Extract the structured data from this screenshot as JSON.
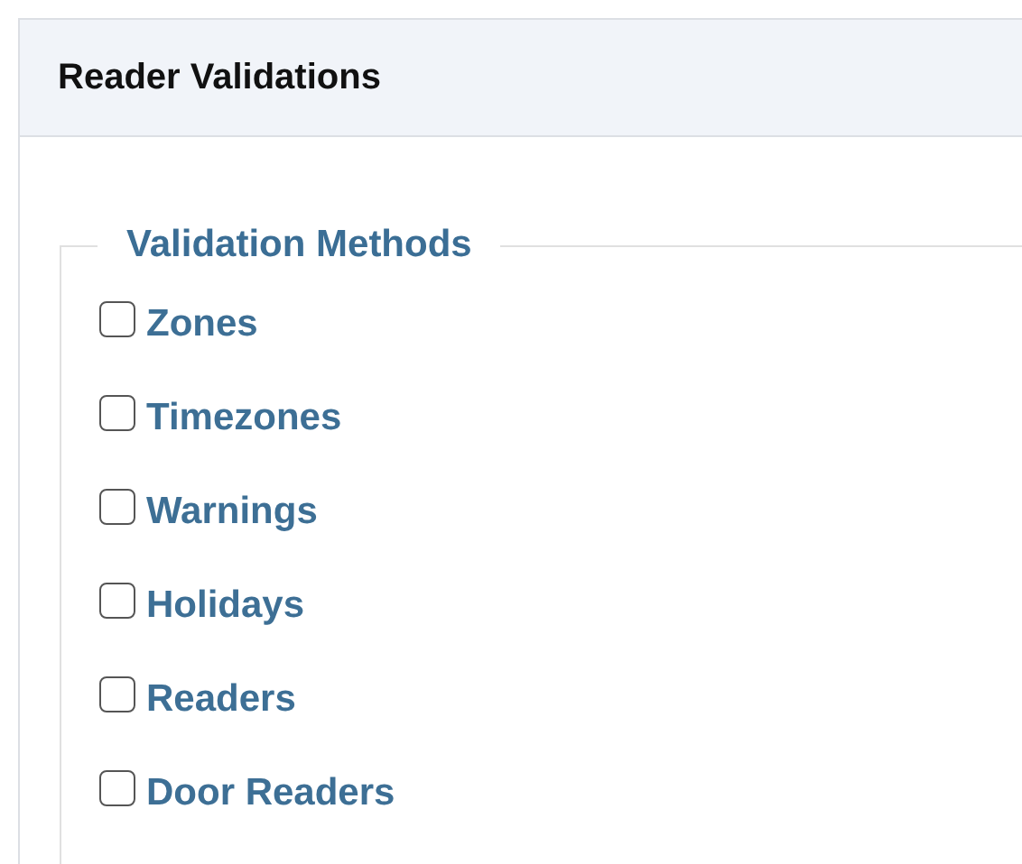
{
  "panel": {
    "title": "Reader Validations"
  },
  "validation_methods": {
    "legend": "Validation Methods",
    "options": [
      {
        "label": "Zones",
        "checked": false
      },
      {
        "label": "Timezones",
        "checked": false
      },
      {
        "label": "Warnings",
        "checked": false
      },
      {
        "label": "Holidays",
        "checked": false
      },
      {
        "label": "Readers",
        "checked": false
      },
      {
        "label": "Door Readers",
        "checked": false
      }
    ]
  }
}
